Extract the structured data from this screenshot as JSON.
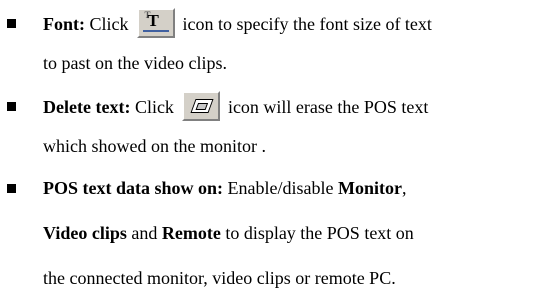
{
  "items": [
    {
      "label": "Font:",
      "text_before_icon": "Click",
      "icon": "font-icon",
      "text_after_icon": "icon to specify the font size of text",
      "continuation": "to past on the video clips."
    },
    {
      "label": "Delete text:",
      "text_before_icon": "Click",
      "icon": "eraser-icon",
      "text_after_icon": "icon will erase the POS text",
      "continuation": "which showed on the monitor ."
    },
    {
      "label": "POS text data show on:",
      "line1_text": "Enable/disable",
      "line1_bold_end": "Monitor",
      "line1_comma": ",",
      "line2_bold_a": "Video clips",
      "line2_and": "and",
      "line2_bold_b": "Remote",
      "line2_rest": "to display the POS text on",
      "line3": "the connected monitor, video clips or remote PC."
    }
  ]
}
